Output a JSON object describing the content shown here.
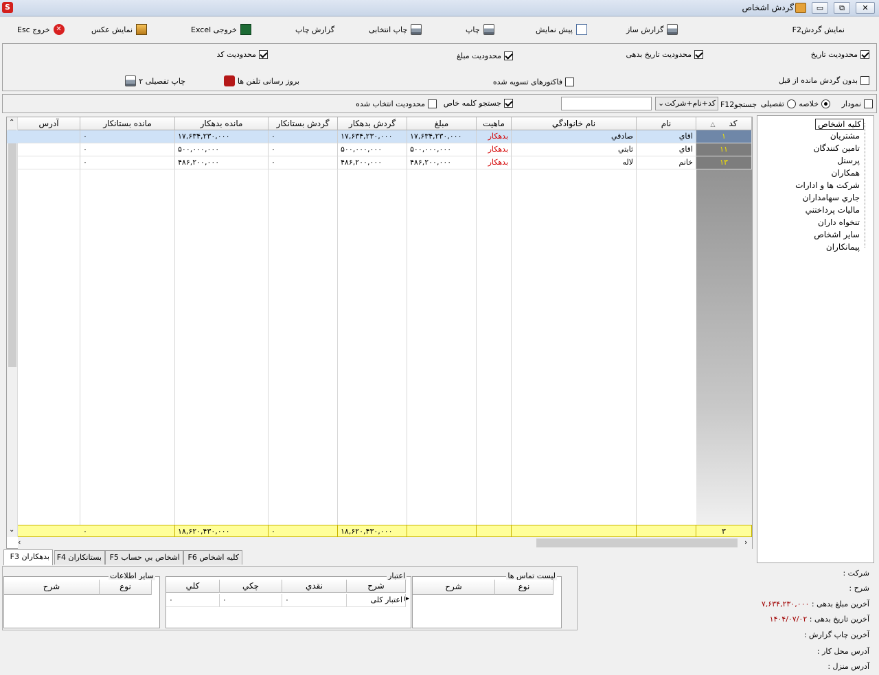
{
  "window": {
    "title": "گردش اشخاص"
  },
  "toolbar": {
    "show_f2": "نمایش گردشF2",
    "report_builder": "گزارش ساز",
    "preview": "پیش نمایش",
    "print": "چاپ",
    "print_selected": "چاپ انتخابی",
    "print_report": "گزارش چاپ",
    "excel": "خروجی Excel",
    "show_photo": "نمایش عکس",
    "exit": "خروج Esc"
  },
  "filters": {
    "date_limit": "محدودیت تاریخ",
    "debt_date_limit": "محدودیت تاریخ بدهی",
    "amount_limit": "محدودیت مبلغ",
    "code_limit": "محدودیت کد",
    "no_prev_balance": "بدون گردش مانده از قبل",
    "settled_invoices": "فاکتورهای تسویه شده",
    "update_phones": "بروز رسانی تلفن ها",
    "print_detail2": "چاپ تفصیلی ۲"
  },
  "search": {
    "chart": "نمودار",
    "summary": "خلاصه",
    "detailed": "تفصیلی",
    "f12": "F12جستجو",
    "mode": "کد+نام+شرکت",
    "value": "",
    "special_word": "جستجو کلمه خاص",
    "selected_limit": "محدودیت انتخاب شده"
  },
  "grid": {
    "headers": {
      "code": "کد",
      "name": "نام",
      "family": "نام خانوادگي",
      "nature": "ماهیت",
      "amount": "مبلغ",
      "debit_turn": "گردش بدهکار",
      "credit_turn": "گردش بستانکار",
      "debit_bal": "مانده بدهکار",
      "credit_bal": "مانده بستانکار",
      "address": "آدرس"
    },
    "rows": [
      {
        "code": "۱",
        "name": "اقاي",
        "family": "صادقي",
        "nature": "بدهكار",
        "amount": "۱۷,۶۳۴,۲۳۰,۰۰۰",
        "debit_turn": "۱۷,۶۳۴,۲۳۰,۰۰۰",
        "credit_turn": "۰",
        "debit_bal": "۱۷,۶۳۴,۲۳۰,۰۰۰",
        "credit_bal": "۰",
        "address": ""
      },
      {
        "code": "۱۱",
        "name": "اقاي",
        "family": "ثابتي",
        "nature": "بدهكار",
        "amount": "۵۰۰,۰۰۰,۰۰۰",
        "debit_turn": "۵۰۰,۰۰۰,۰۰۰",
        "credit_turn": "۰",
        "debit_bal": "۵۰۰,۰۰۰,۰۰۰",
        "credit_bal": "۰",
        "address": ""
      },
      {
        "code": "۱۳",
        "name": "خانم",
        "family": "لاله",
        "nature": "بدهكار",
        "amount": "۴۸۶,۲۰۰,۰۰۰",
        "debit_turn": "۴۸۶,۲۰۰,۰۰۰",
        "credit_turn": "۰",
        "debit_bal": "۴۸۶,۲۰۰,۰۰۰",
        "credit_bal": "۰",
        "address": ""
      }
    ],
    "footer": {
      "count": "۳",
      "debit_turn": "۱۸,۶۲۰,۴۳۰,۰۰۰",
      "credit_turn": "۰",
      "debit_bal": "۱۸,۶۲۰,۴۳۰,۰۰۰",
      "credit_bal": "۰"
    }
  },
  "tree": {
    "items": [
      "كليه اشخاص",
      "مشتريان",
      "تامين كنندگان",
      "پرسنل",
      "همكاران",
      "شركت ها و ادارات",
      "جاري سهامداران",
      "ماليات پرداختني",
      "تنخواه داران",
      "ساير اشخاص",
      "پيمانكاران"
    ]
  },
  "tabs": [
    "بدهكاران F3",
    "بستانكاران F4",
    "اشخاص بي حساب F5",
    "کلیه اشخاص F6"
  ],
  "contacts": {
    "title": "لیست تماس ها",
    "type": "نوع",
    "desc": "شرح"
  },
  "credit": {
    "title": "اعتبار",
    "desc": "شرح",
    "cash": "نقدي",
    "cheque": "چكي",
    "total": "كلي",
    "row_label": "اعتبار کلی",
    "row_cash": "۰",
    "row_cheque": "۰",
    "row_total": "۰"
  },
  "other": {
    "title": "ساير اطلاعات",
    "type": "نوع",
    "desc": "شرح"
  },
  "info": {
    "company": "شرکت :",
    "desc": "شرح :",
    "last_debt_amount": "آخرین مبلغ بدهی :",
    "last_debt_amount_val": "۷,۶۳۴,۲۳۰,۰۰۰",
    "last_debt_date": "آخرین تاریخ بدهی :",
    "last_debt_date_val": "۱۴۰۴/۰۷/۰۲",
    "last_print": "آخرین چاپ گزارش :",
    "work_addr": "آدرس محل کار :",
    "home_addr": "آدرس منزل :"
  }
}
